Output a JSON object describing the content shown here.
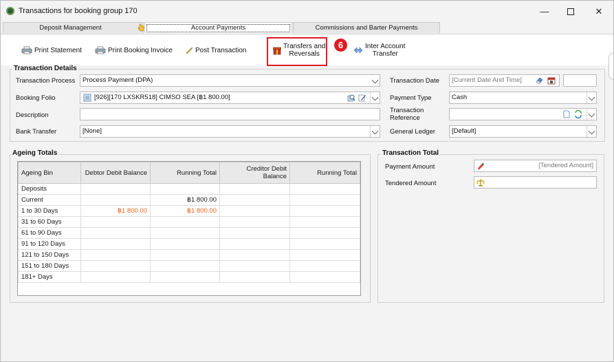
{
  "window": {
    "title": "Transactions for booking group 170"
  },
  "tabs": [
    {
      "label": "Deposit Management"
    },
    {
      "label": "Account Payments"
    },
    {
      "label": "Commissions and Barter Payments"
    }
  ],
  "toolbar": {
    "print_statement": "Print Statement",
    "print_booking_invoice": "Print Booking Invoice",
    "post_transaction": "Post Transaction",
    "transfers_line1": "Transfers and",
    "transfers_line2": "Reversals",
    "step_badge": "6",
    "inter_account_line1": "Inter Account",
    "inter_account_line2": "Transfer"
  },
  "details": {
    "legend": "Transaction Details",
    "transaction_process_label": "Transaction Process",
    "transaction_process_value": "Process Payment (DPA)",
    "booking_folio_label": "Booking Folio",
    "booking_folio_value": "[926][170 LXSKR518] CIMSO SEA [฿1 800.00]",
    "description_label": "Description",
    "bank_transfer_label": "Bank Transfer",
    "bank_transfer_value": "[None]",
    "transaction_date_label": "Transaction Date",
    "transaction_date_placeholder": "[Current Date And Time]",
    "payment_type_label": "Payment Type",
    "payment_type_value": "Cash",
    "transaction_reference_label_1": "Transaction",
    "transaction_reference_label_2": "Reference",
    "general_ledger_label": "General Ledger",
    "general_ledger_value": "[Default]"
  },
  "ageing": {
    "legend": "Ageing Totals",
    "columns": [
      "Ageing Bin",
      "Debtor Debit Balance",
      "Running Total",
      "Creditor Debit Balance",
      "Running Total"
    ],
    "rows": [
      {
        "bin": "Deposits",
        "debtor": "",
        "running": "",
        "creditor": "",
        "running2": ""
      },
      {
        "bin": "Current",
        "debtor": "",
        "running": "฿1 800.00",
        "creditor": "",
        "running2": ""
      },
      {
        "bin": "1 to 30 Days",
        "debtor": "฿1 800.00",
        "running": "฿1 800.00",
        "creditor": "",
        "running2": ""
      },
      {
        "bin": "31 to 60 Days",
        "debtor": "",
        "running": "",
        "creditor": "",
        "running2": ""
      },
      {
        "bin": "61 to 90 Days",
        "debtor": "",
        "running": "",
        "creditor": "",
        "running2": ""
      },
      {
        "bin": "91 to 120 Days",
        "debtor": "",
        "running": "",
        "creditor": "",
        "running2": ""
      },
      {
        "bin": "121 to 150 Days",
        "debtor": "",
        "running": "",
        "creditor": "",
        "running2": ""
      },
      {
        "bin": "151 to 180 Days",
        "debtor": "",
        "running": "",
        "creditor": "",
        "running2": ""
      },
      {
        "bin": "181+ Days",
        "debtor": "",
        "running": "",
        "creditor": "",
        "running2": ""
      }
    ]
  },
  "total": {
    "legend": "Transaction Total",
    "payment_amount_label": "Payment Amount",
    "payment_amount_placeholder": "[Tendered Amount]",
    "tendered_amount_label": "Tendered Amount"
  },
  "colors": {
    "highlight": "#e01b24",
    "orange_amount": "#e8641b"
  }
}
